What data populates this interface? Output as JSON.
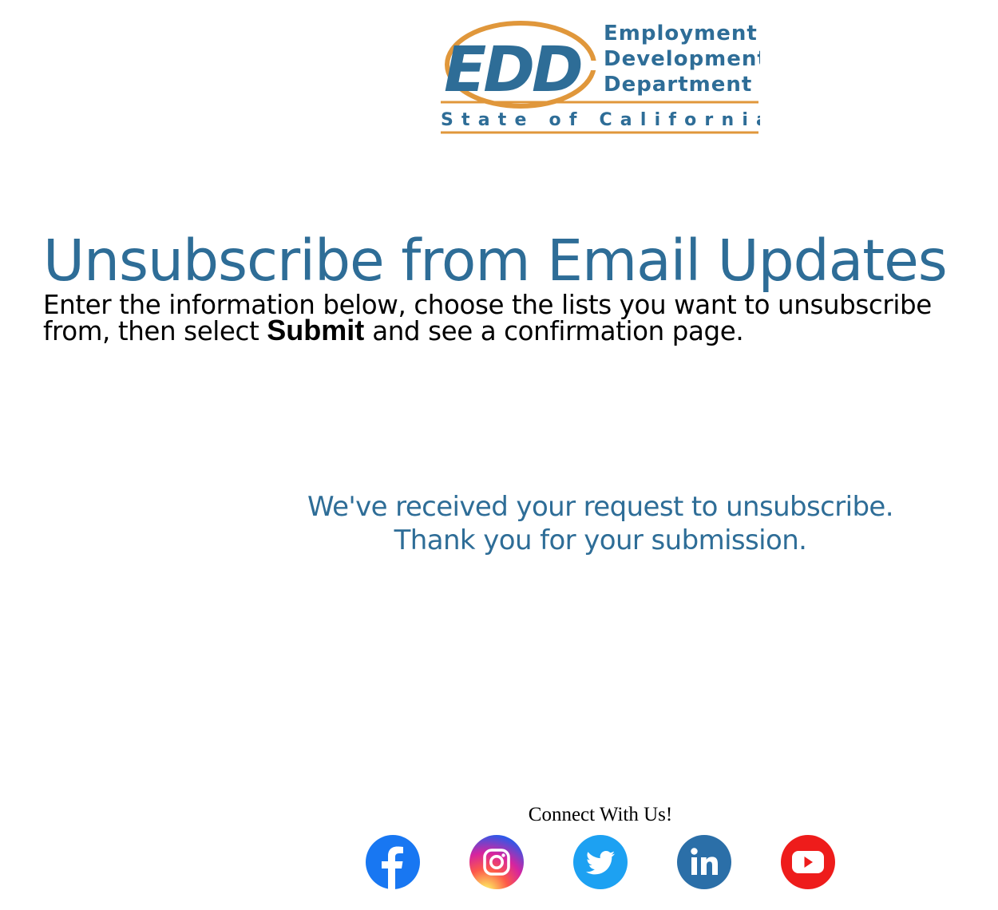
{
  "logo": {
    "acronym": "EDD",
    "name_lines": [
      "Employment",
      "Development",
      "Department"
    ],
    "tagline": "State of California",
    "colors": {
      "blue": "#2e6d97",
      "orange": "#e0973b"
    }
  },
  "page": {
    "title": "Unsubscribe from Email Updates",
    "instructions_before": "Enter the information below, choose the lists you want to unsubscribe from, then select ",
    "instructions_bold": "Submit",
    "instructions_after": " and see a confirmation page."
  },
  "confirmation": {
    "line1": "We've received your request to unsubscribe.",
    "line2": "Thank you for your submission."
  },
  "footer": {
    "connect_heading": "Connect With Us!",
    "social_links": [
      {
        "icon": "facebook-icon",
        "color": "#1877f2"
      },
      {
        "icon": "instagram-icon",
        "color": "#d6249f"
      },
      {
        "icon": "twitter-icon",
        "color": "#1da1f2"
      },
      {
        "icon": "linkedin-icon",
        "color": "#0a66c2"
      },
      {
        "icon": "youtube-icon",
        "color": "#ee1c1b"
      }
    ]
  }
}
